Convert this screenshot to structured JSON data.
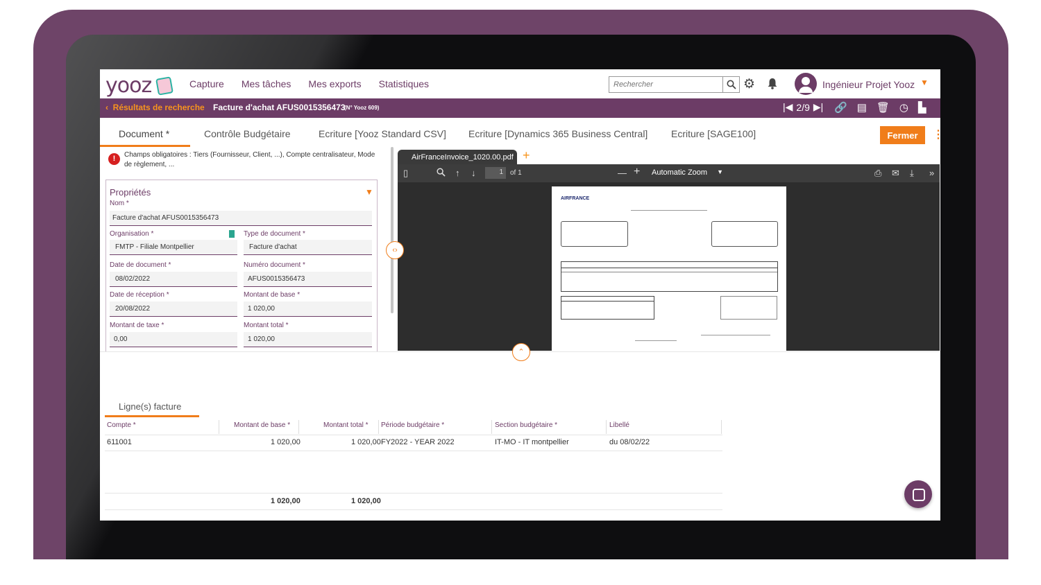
{
  "app": {
    "logo": "yooz",
    "colors": {
      "primary": "#6c3c66",
      "accent": "#f07d1a",
      "pdf_bg": "#2d2d2d"
    }
  },
  "nav": {
    "links": [
      "Capture",
      "Mes tâches",
      "Mes exports",
      "Statistiques"
    ],
    "search_placeholder": "Rechercher",
    "user_name": "Ingénieur Projet Yooz"
  },
  "subbar": {
    "back_label": "Résultats de recherche",
    "doc_title": "Facture d'achat AFUS0015356473",
    "doc_num": "(N° Yooz 609)",
    "pager": "2/9"
  },
  "tabs": {
    "items": [
      "Document *",
      "Contrôle Budgétaire",
      "Ecriture [Yooz Standard CSV]",
      "Ecriture [Dynamics 365 Business Central]",
      "Ecriture [SAGE100]"
    ],
    "close_label": "Fermer"
  },
  "alert": {
    "text": "Champs obligatoires : Tiers (Fournisseur, Client, ...), Compte centralisateur, Mode de règlement, ..."
  },
  "props": {
    "title": "Propriétés",
    "fields": {
      "nom": {
        "label": "Nom *",
        "value": "Facture d'achat AFUS0015356473"
      },
      "organisation": {
        "label": "Organisation *",
        "value": "FMTP - Filiale Montpellier"
      },
      "type_document": {
        "label": "Type de document *",
        "value": "Facture d'achat"
      },
      "date_document": {
        "label": "Date de document *",
        "value": "08/02/2022"
      },
      "numero_document": {
        "label": "Numéro document *",
        "value": "AFUS0015356473"
      },
      "date_reception": {
        "label": "Date de réception *",
        "value": "20/08/2022"
      },
      "montant_base": {
        "label": "Montant de base *",
        "value": "1 020,00"
      },
      "montant_taxe": {
        "label": "Montant de taxe *",
        "value": "0,00"
      },
      "montant_total": {
        "label": "Montant total *",
        "value": "1 020,00"
      }
    }
  },
  "pdf": {
    "tab_name": "AirFranceInvoice_1020.00.pdf",
    "page": "1",
    "of_pages": "of 1",
    "zoom": "Automatic Zoom",
    "sheet_brand": "AIRFRANCE"
  },
  "lines": {
    "title": "Ligne(s) facture",
    "headers": [
      "Compte *",
      "Montant de base *",
      "Montant total *",
      "Période budgétaire *",
      "Section budgétaire *",
      "Libellé"
    ],
    "rows": [
      {
        "compte": "611001",
        "montant_base": "1 020,00",
        "montant_total": "1 020,00",
        "periode": "FY2022 - YEAR 2022",
        "section": "IT-MO - IT montpellier",
        "libelle": "du 08/02/22"
      }
    ],
    "total_base": "1 020,00",
    "total_total": "1 020,00"
  }
}
